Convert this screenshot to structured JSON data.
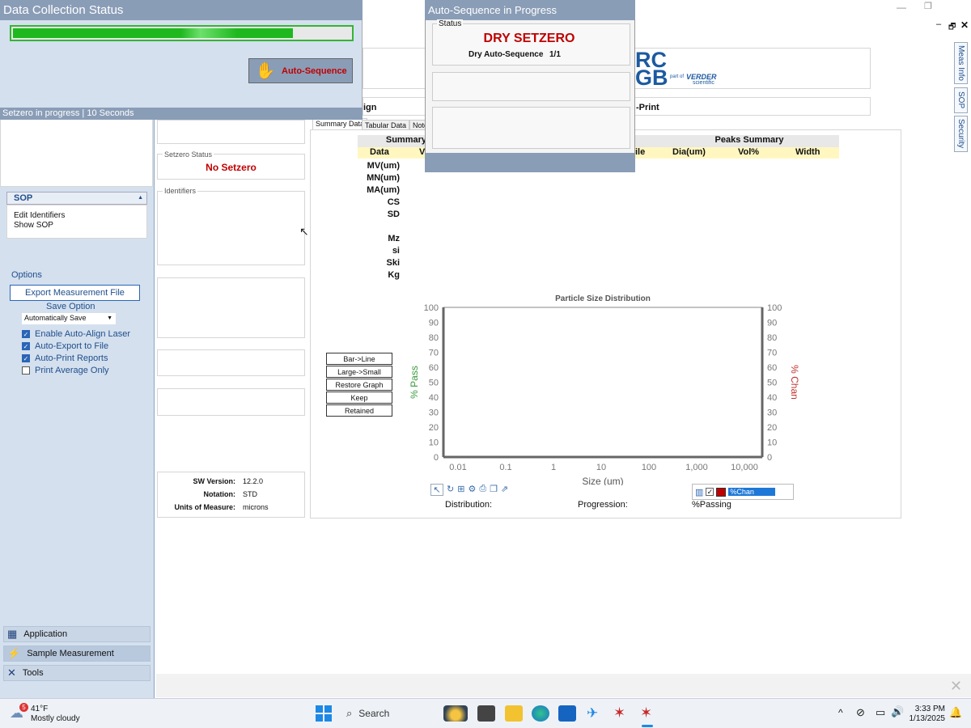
{
  "data_collection": {
    "title": "Data Collection Status",
    "progress": 0.83,
    "auto_seq_button": "Auto-Sequence",
    "status_line": "Setzero in progress | 10 Seconds"
  },
  "auto_seq_dialog": {
    "title": "Auto-Sequence in Progress",
    "status_group": "Status",
    "main": "DRY SETZERO",
    "detail_label": "Dry Auto-Sequence",
    "detail_value": "1/1"
  },
  "header": {
    "logo_partial": "RC\nGB",
    "part_of": "part of",
    "verder": "VERDER",
    "scientific": "scientific",
    "align_partial": "ign",
    "print_partial": "-Print"
  },
  "right_tabs": [
    "Meas Info",
    "SOP",
    "Security"
  ],
  "left_panel": {
    "sop_header": "SOP",
    "sop_items": [
      "Edit Identifiers",
      "Show SOP"
    ],
    "options_header": "Options",
    "export_button": "Export Measurement File",
    "save_option_label": "Save Option",
    "save_option_value": "Automatically Save",
    "checkboxes": [
      {
        "label": "Enable Auto-Align Laser",
        "checked": true
      },
      {
        "label": "Auto-Export to File",
        "checked": true
      },
      {
        "label": "Auto-Print Reports",
        "checked": true
      },
      {
        "label": "Print Average Only",
        "checked": false
      }
    ],
    "nav": [
      "Application",
      "Sample Measurement",
      "Tools"
    ]
  },
  "middle": {
    "setzero_label": "Setzero Status",
    "setzero_value": "No Setzero",
    "identifiers_label": "Identifiers",
    "sw_version_label": "SW Version:",
    "sw_version_value": "12.2.0",
    "notation_label": "Notation:",
    "notation_value": "STD",
    "units_label": "Units of Measure:",
    "units_value": "microns"
  },
  "main": {
    "tabs": [
      "Summary Data",
      "Tabular Data",
      "Note"
    ],
    "summary_title": "Summary",
    "summary_col_data": "Data",
    "summary_col_v": "V",
    "summary_rows": [
      "MV(um)",
      "MN(um)",
      "MA(um)",
      "CS",
      "SD",
      "",
      "Mz",
      "si",
      "Ski",
      "Kg"
    ],
    "peaks_title": "Peaks Summary",
    "peaks_cols": [
      "ile",
      "Dia(um)",
      "Vol%",
      "Width"
    ],
    "graph_buttons": [
      "Bar->Line",
      "Large->Small",
      "Restore Graph",
      "Keep",
      "Retained"
    ],
    "distribution_label": "Distribution:",
    "progression_label": "Progression:",
    "passing_label": "%Passing",
    "chan_select": "%Chan"
  },
  "chart_data": {
    "type": "line",
    "title": "Particle Size Distribution",
    "xlabel": "Size (um)",
    "ylabel": "% Pass",
    "y2label": "% Chan",
    "x_scale": "log",
    "xlim": [
      0.01,
      10000
    ],
    "x_ticks": [
      "0.01",
      "0.1",
      "1",
      "10",
      "100",
      "1,000",
      "10,000"
    ],
    "ylim": [
      0,
      100
    ],
    "y_ticks": [
      "0",
      "10",
      "20",
      "30",
      "40",
      "50",
      "60",
      "70",
      "80",
      "90",
      "100"
    ],
    "series": [],
    "colors": {
      "y1": "#3a9a3a",
      "y2": "#c03030"
    }
  },
  "taskbar": {
    "weather_badge": "5",
    "temp": "41°F",
    "condition": "Mostly cloudy",
    "search": "Search",
    "time": "3:33 PM",
    "date": "1/13/2025"
  }
}
